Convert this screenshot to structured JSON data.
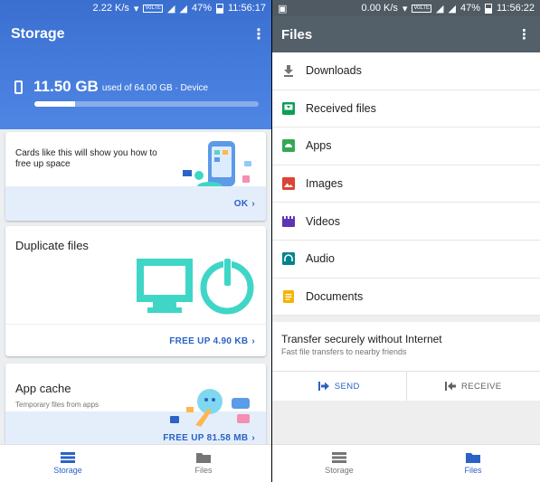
{
  "left": {
    "status": {
      "speed": "2.22 K/s",
      "lte": "VoLTE",
      "battery": "47%",
      "time": "11:56:17"
    },
    "appbar": {
      "title": "Storage",
      "menu_icon": "more-vert-icon"
    },
    "storage": {
      "used": "11.50 GB",
      "detail": "used of 64.00 GB · Device",
      "fill_fraction": 0.18
    },
    "intro_card": {
      "text": "Cards like this will show you how to free up space",
      "action": "OK"
    },
    "duplicate_card": {
      "title": "Duplicate files",
      "action": "FREE UP 4.90 KB"
    },
    "cache_card": {
      "title": "App cache",
      "subtitle": "Temporary files from apps",
      "action": "FREE UP 81.58 MB"
    },
    "bottom_nav": [
      {
        "label": "Storage",
        "icon": "storage-list-icon",
        "active": true
      },
      {
        "label": "Files",
        "icon": "folder-icon",
        "active": false
      }
    ]
  },
  "right": {
    "status": {
      "speed": "0.00 K/s",
      "lte": "VoLTE",
      "battery": "47%",
      "time": "11:56:22"
    },
    "appbar": {
      "title": "Files",
      "menu_icon": "more-vert-icon"
    },
    "files": [
      {
        "label": "Downloads",
        "icon": "download-icon",
        "color": "#757575"
      },
      {
        "label": "Received files",
        "icon": "received-files-icon",
        "color": "#0f9d58"
      },
      {
        "label": "Apps",
        "icon": "android-icon",
        "color": "#34a853"
      },
      {
        "label": "Images",
        "icon": "image-icon",
        "color": "#db4437"
      },
      {
        "label": "Videos",
        "icon": "video-icon",
        "color": "#5e35b1"
      },
      {
        "label": "Audio",
        "icon": "headphones-icon",
        "color": "#00838f"
      },
      {
        "label": "Documents",
        "icon": "document-icon",
        "color": "#f4b400"
      }
    ],
    "transfer": {
      "title": "Transfer securely without Internet",
      "subtitle": "Fast file transfers to nearby friends",
      "send": "SEND",
      "receive": "RECEIVE"
    },
    "bottom_nav": [
      {
        "label": "Storage",
        "icon": "storage-list-icon",
        "active": false
      },
      {
        "label": "Files",
        "icon": "folder-icon",
        "active": true
      }
    ]
  },
  "colors": {
    "accent": "#2b62c6",
    "hero_blue": "#4a7fe0",
    "files_appbar": "#535f69",
    "illustration_teal": "#3fd6c6"
  }
}
